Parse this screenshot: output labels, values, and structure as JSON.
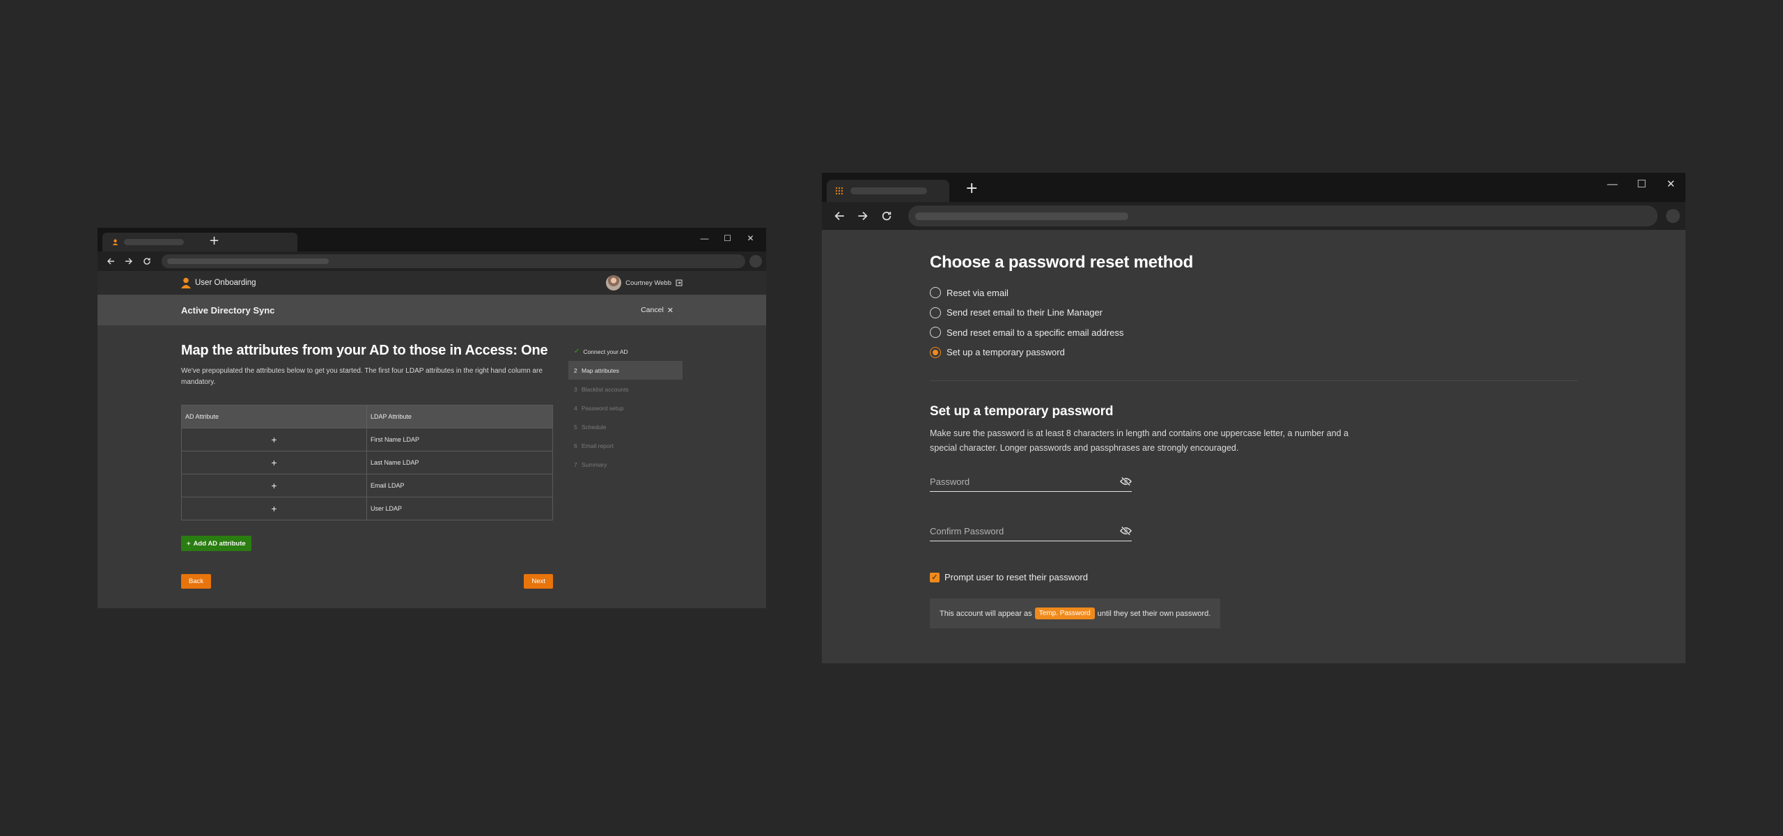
{
  "left_window": {
    "app": {
      "title": "User Onboarding",
      "user_name": "Courtney Webb"
    },
    "subbar": {
      "title": "Active Directory Sync",
      "cancel_label": "Cancel"
    },
    "heading": "Map the attributes from your AD to those in Access: One",
    "description": "We've prepopulated the attributes below to get you started. The first four LDAP attributes in the right hand column are mandatory.",
    "table": {
      "headers": [
        "AD Attribute",
        "LDAP Attribute"
      ],
      "rows": [
        {
          "ad": "+",
          "ldap": "First Name LDAP"
        },
        {
          "ad": "+",
          "ldap": "Last Name LDAP"
        },
        {
          "ad": "+",
          "ldap": "Email LDAP"
        },
        {
          "ad": "+",
          "ldap": "User LDAP"
        }
      ]
    },
    "add_button": "Add AD attribute",
    "back_label": "Back",
    "next_label": "Next",
    "steps": [
      {
        "num": "",
        "label": "Connect your AD",
        "state": "done"
      },
      {
        "num": "2",
        "label": "Map attributes",
        "state": "active"
      },
      {
        "num": "3",
        "label": "Blacklist accounts",
        "state": "pending"
      },
      {
        "num": "4",
        "label": "Password setup",
        "state": "pending"
      },
      {
        "num": "5",
        "label": "Schedule",
        "state": "pending"
      },
      {
        "num": "6",
        "label": "Email report",
        "state": "pending"
      },
      {
        "num": "7",
        "label": "Summary",
        "state": "pending"
      }
    ]
  },
  "right_window": {
    "heading": "Choose a password reset method",
    "options": [
      {
        "label": "Reset via email",
        "selected": false
      },
      {
        "label": "Send reset email to their Line Manager",
        "selected": false
      },
      {
        "label": "Send reset email to a specific email address",
        "selected": false
      },
      {
        "label": "Set up a temporary password",
        "selected": true
      }
    ],
    "section_title": "Set up a temporary password",
    "section_desc": "Make sure the password is at least 8 characters in length and contains one uppercase letter, a number and a special character. Longer passwords and passphrases are strongly encouraged.",
    "password_placeholder": "Password",
    "confirm_placeholder": "Confirm Password",
    "prompt_label": "Prompt user to reset their password",
    "prompt_checked": true,
    "note_before": "This account will appear as",
    "note_tag": "Temp. Password",
    "note_after": "until they set their own password."
  },
  "colors": {
    "accent_orange": "#e8740c",
    "add_green": "#2a7d10",
    "check_green": "#3aa70f",
    "page_bg": "#282828"
  }
}
